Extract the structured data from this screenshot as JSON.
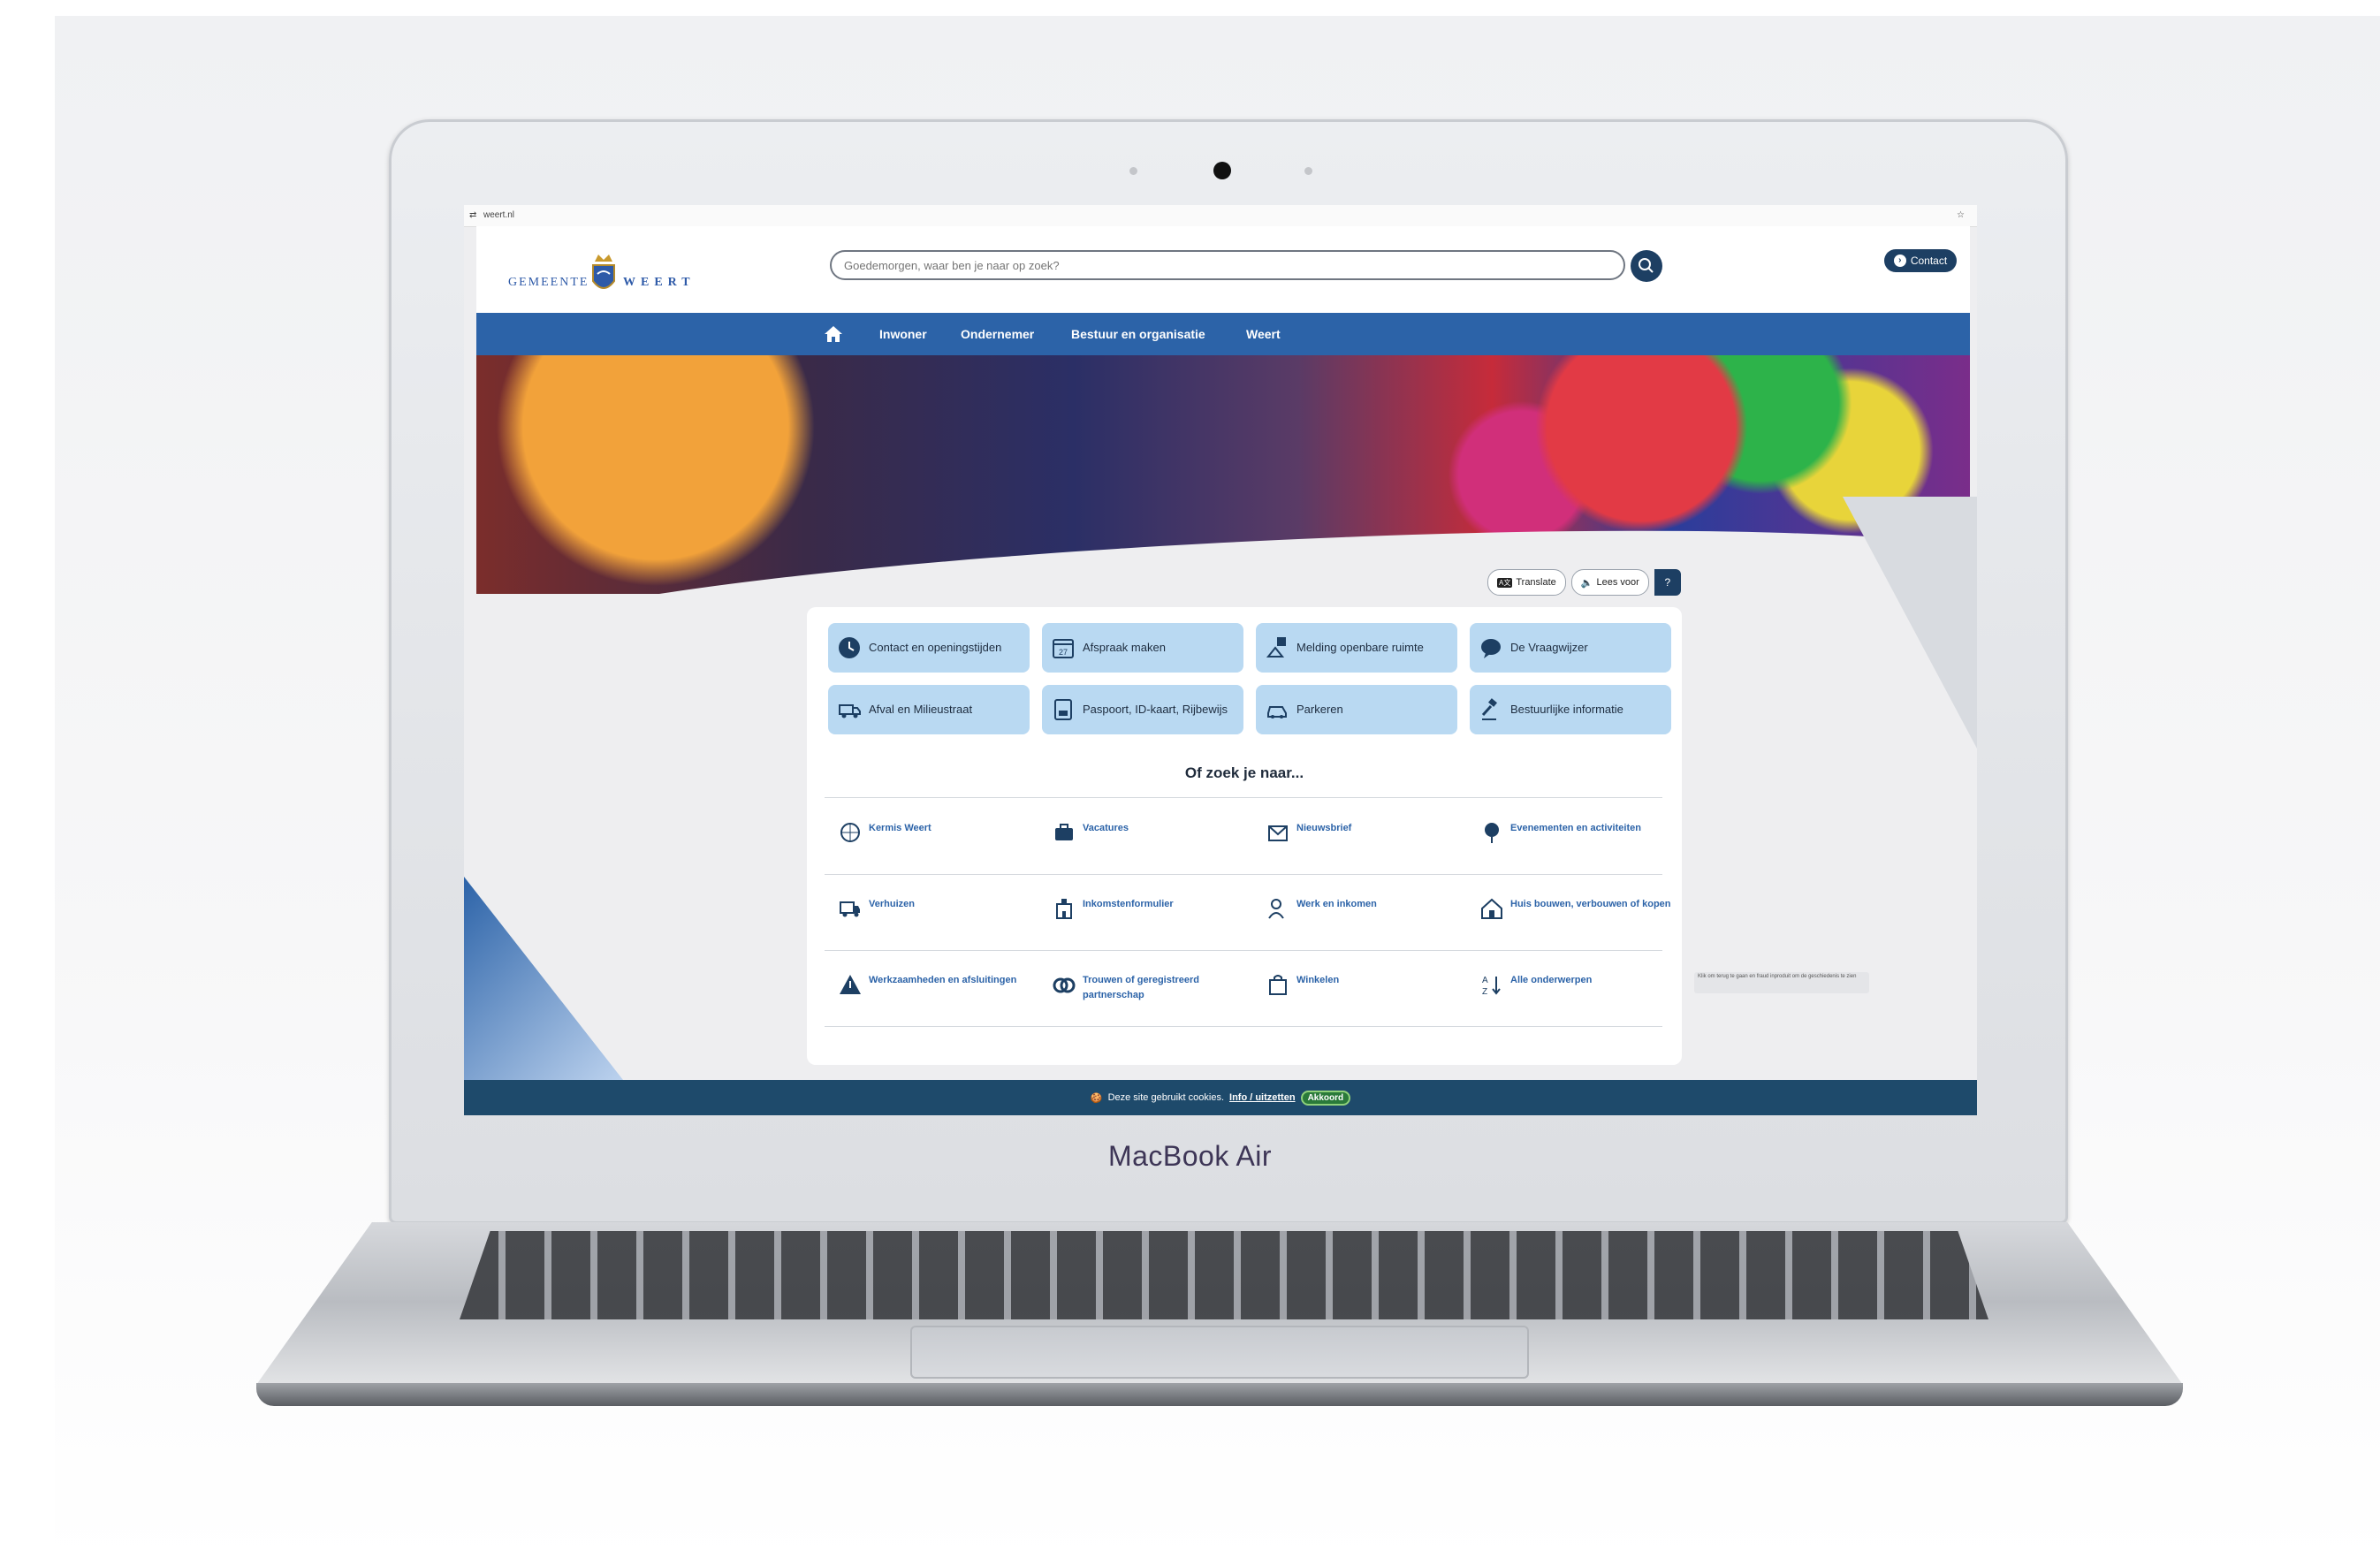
{
  "browser": {
    "url": "weert.nl",
    "star_icon": "star-icon"
  },
  "header": {
    "logo_left": "GEMEENTE",
    "logo_right": "WEERT",
    "search_placeholder": "Goedemorgen, waar ben je naar op zoek?",
    "contact_label": "Contact"
  },
  "nav": {
    "items": [
      "Inwoner",
      "Ondernemer",
      "Bestuur en organisatie",
      "Weert"
    ]
  },
  "tools": {
    "translate": "Translate",
    "read": "Lees voor",
    "help": "?"
  },
  "quick_links": [
    {
      "label": "Contact en openingstijden",
      "icon": "clock-icon"
    },
    {
      "label": "Afspraak maken",
      "icon": "calendar-icon"
    },
    {
      "label": "Melding openbare ruimte",
      "icon": "report-icon"
    },
    {
      "label": "De Vraagwijzer",
      "icon": "chat-icon"
    },
    {
      "label": "Afval en Milieustraat",
      "icon": "truck-icon"
    },
    {
      "label": "Paspoort, ID-kaart, Rijbewijs",
      "icon": "passport-icon"
    },
    {
      "label": "Parkeren",
      "icon": "car-icon"
    },
    {
      "label": "Bestuurlijke informatie",
      "icon": "gavel-icon"
    }
  ],
  "or_search": "Of zoek je naar...",
  "more_links": [
    {
      "label": "Kermis Weert",
      "icon": "fair-icon"
    },
    {
      "label": "Vacatures",
      "icon": "briefcase-icon"
    },
    {
      "label": "Nieuwsbrief",
      "icon": "mail-icon"
    },
    {
      "label": "Evenementen en activiteiten",
      "icon": "balloon-icon"
    },
    {
      "label": "Verhuizen",
      "icon": "moving-truck-icon"
    },
    {
      "label": "Inkomstenformulier",
      "icon": "building-icon"
    },
    {
      "label": "Werk en inkomen",
      "icon": "person-icon"
    },
    {
      "label": "Huis bouwen, verbouwen of kopen",
      "icon": "house-icon"
    },
    {
      "label": "Werkzaamheden en afsluitingen",
      "icon": "warning-icon"
    },
    {
      "label": "Trouwen of geregistreerd partnerschap",
      "icon": "rings-icon"
    },
    {
      "label": "Winkelen",
      "icon": "shopping-bag-icon"
    },
    {
      "label": "Alle onderwerpen",
      "icon": "sort-az-icon"
    }
  ],
  "tooltip": "Klik om terug te gaan en fraud inproduit om de geschiedenis te zien",
  "cookie": {
    "text": "Deze site gebruikt cookies.",
    "link": "Info / uitzetten",
    "button": "Akkoord"
  },
  "device_label": "MacBook Air"
}
